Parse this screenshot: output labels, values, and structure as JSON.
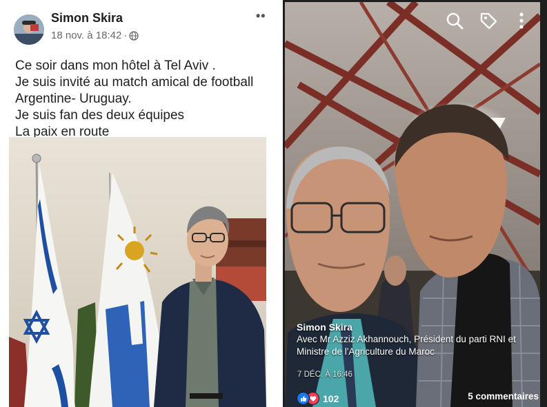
{
  "left_post": {
    "author": "Simon Skira",
    "timestamp": "18 nov. à 18:42",
    "separator": "·",
    "privacy_icon": "globe-icon",
    "more_icon": "more-dots-icon",
    "more_glyph": "••",
    "text_lines": [
      "Ce soir dans mon hôtel à Tel Aviv .",
      "Je suis invité au match amical de football",
      "Argentine- Uruguay.",
      "Je suis fan des deux équipes",
      "La paix en route"
    ]
  },
  "right_post": {
    "toolbar_icons": [
      "search-icon",
      "tag-icon",
      "more-vertical-icon"
    ],
    "author": "Simon Skira",
    "caption_lines": [
      "Avec  Mr Azziz Akhannouch,  Président du parti RNI et",
      "Ministre de l'Agriculture du Maroc"
    ],
    "date": "7 DÉC. À 16:46",
    "reaction_icons": [
      "like-icon",
      "love-icon"
    ],
    "reaction_count": "102",
    "comments": "5 commentaires"
  },
  "colors": {
    "facebook_blue": "#1877f2",
    "love_red": "#f33e58",
    "israel_blue": "#1f4fa0",
    "uruguay_blue": "#2f63b8",
    "sun_gold": "#d9a520"
  }
}
